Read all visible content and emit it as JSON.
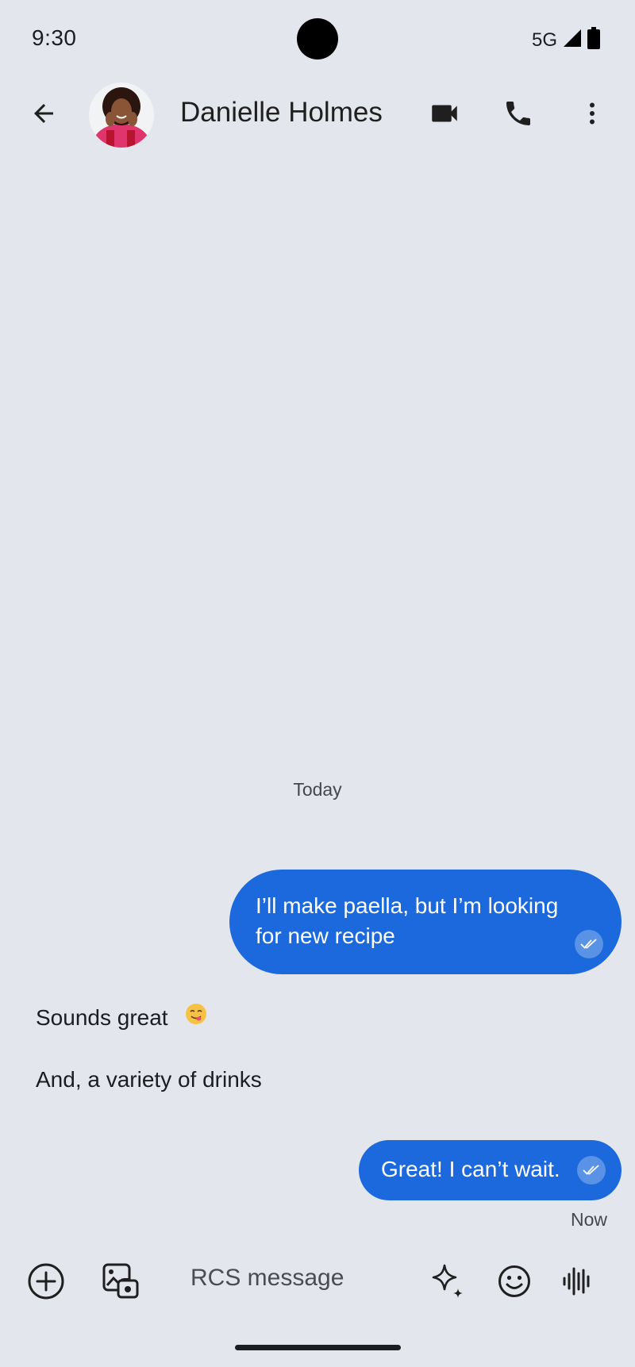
{
  "status_bar": {
    "time": "9:30",
    "network": "5G",
    "icons": [
      "signal-icon",
      "battery-icon"
    ]
  },
  "header": {
    "contact_name": "Danielle Holmes",
    "icons": [
      "back-arrow-icon",
      "avatar",
      "video-call-icon",
      "phone-icon",
      "more-vert-icon"
    ]
  },
  "conversation": {
    "date_label": "Today",
    "messages": [
      {
        "direction": "outgoing",
        "text": "I’ll make paella, but I’m looking for new recipe",
        "status": "read"
      },
      {
        "direction": "incoming",
        "text": "Sounds great",
        "emoji": "face-savoring-food"
      },
      {
        "direction": "incoming",
        "text": "And, a variety of drinks"
      },
      {
        "direction": "outgoing",
        "text": "Great! I can’t wait.",
        "status": "read"
      }
    ],
    "last_timestamp": "Now"
  },
  "compose": {
    "placeholder": "RCS message",
    "icons": [
      "add-icon",
      "gallery-icon",
      "magic-compose-icon",
      "emoji-icon",
      "voice-message-icon"
    ]
  },
  "colors": {
    "background": "#e3e6ec",
    "outgoing_bubble": "#1b69dd",
    "text": "#1c1d21"
  }
}
